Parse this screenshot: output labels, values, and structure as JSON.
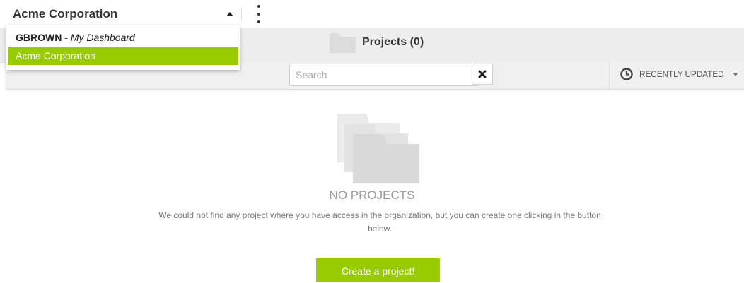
{
  "topbar": {
    "org_name": "Acme Corporation",
    "menu_icon": "more-vertical-icon"
  },
  "dropdown": {
    "items": [
      {
        "user": "GBROWN",
        "separator": " - ",
        "label": "My Dashboard"
      },
      {
        "label": "Acme Corporation",
        "selected": true
      }
    ]
  },
  "header": {
    "title": "Projects (0)",
    "icon": "folder-icon"
  },
  "toolbar": {
    "search_placeholder": "Search",
    "search_value": "",
    "clear_icon": "close-icon",
    "sort_icon": "clock-icon",
    "sort_label": "RECENTLY UPDATED"
  },
  "empty_state": {
    "icon": "folders-icon",
    "title": "NO PROJECTS",
    "description": "We could not find any project where you have access in the organization, but you can create one clicking in the button below.",
    "button_label": "Create a project!"
  },
  "colors": {
    "accent": "#99cc00",
    "header_bg": "#ededed",
    "toolbar_bg": "#f0f0f0",
    "icon_grey": "#dcdcdc"
  }
}
